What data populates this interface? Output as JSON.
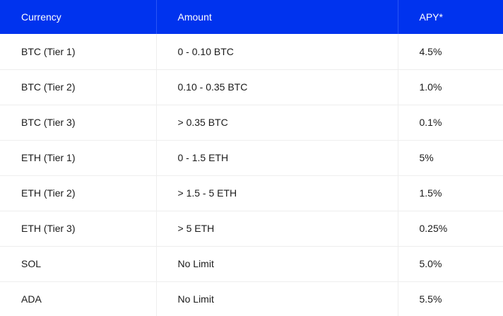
{
  "table": {
    "headers": [
      "Currency",
      "Amount",
      "APY*"
    ],
    "rows": [
      {
        "currency": "BTC (Tier 1)",
        "amount": "0 - 0.10 BTC",
        "apy": "4.5%"
      },
      {
        "currency": "BTC (Tier 2)",
        "amount": "0.10 - 0.35 BTC",
        "apy": "1.0%"
      },
      {
        "currency": "BTC (Tier 3)",
        "amount": "> 0.35 BTC",
        "apy": "0.1%"
      },
      {
        "currency": "ETH (Tier 1)",
        "amount": "0 - 1.5 ETH",
        "apy": "5%"
      },
      {
        "currency": "ETH (Tier 2)",
        "amount": "> 1.5 - 5 ETH",
        "apy": "1.5%"
      },
      {
        "currency": "ETH (Tier 3)",
        "amount": "> 5 ETH",
        "apy": "0.25%"
      },
      {
        "currency": "SOL",
        "amount": "No Limit",
        "apy": "5.0%"
      },
      {
        "currency": "ADA",
        "amount": "No Limit",
        "apy": "5.5%"
      }
    ]
  },
  "colors": {
    "header_background": "#0033ee",
    "header_text": "#ffffff",
    "body_text": "#1a1a1a",
    "row_divider": "#eeeeee"
  }
}
